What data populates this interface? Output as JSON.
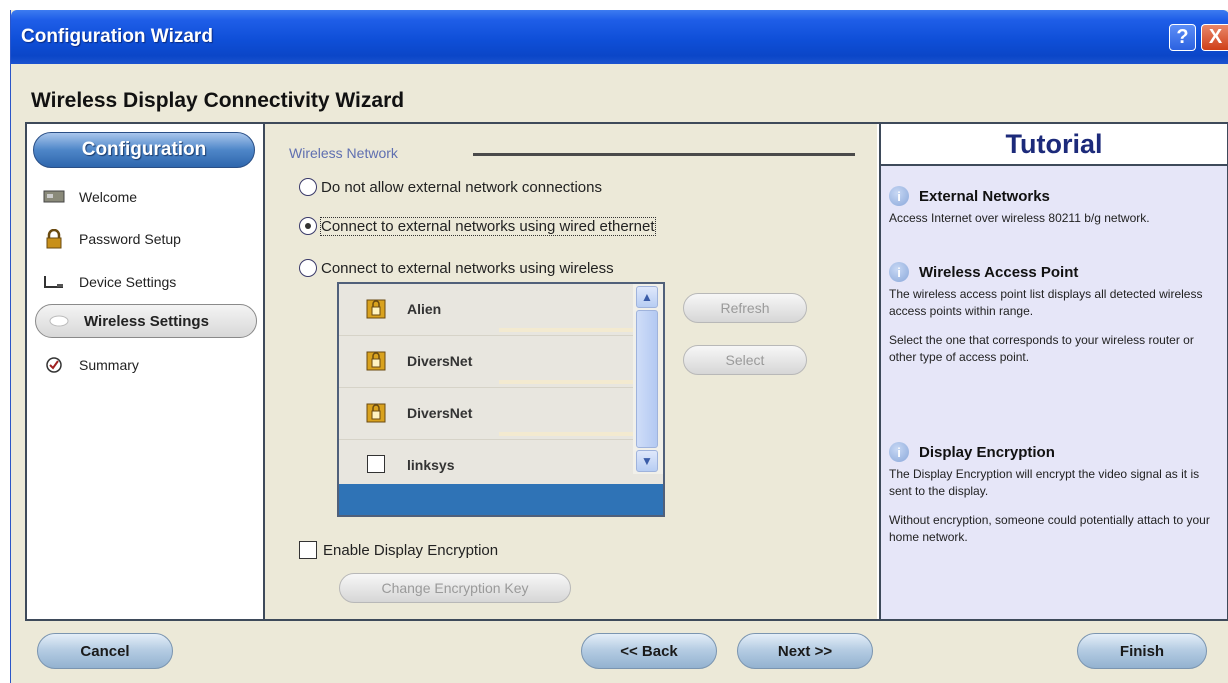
{
  "window": {
    "title": "Configuration Wizard",
    "help_label": "?",
    "close_label": "X"
  },
  "wizard_title": "Wireless Display Connectivity Wizard",
  "sidebar": {
    "header": "Configuration",
    "items": [
      {
        "label": "Welcome",
        "icon": "monitor-icon"
      },
      {
        "label": "Password Setup",
        "icon": "lock-icon"
      },
      {
        "label": "Device Settings",
        "icon": "device-settings-icon"
      },
      {
        "label": "Wireless Settings",
        "icon": "wireless-icon",
        "active": true
      },
      {
        "label": "Summary",
        "icon": "summary-icon"
      }
    ]
  },
  "main": {
    "group_label": "Wireless Network",
    "options": [
      {
        "label": "Do not allow external network connections",
        "selected": false
      },
      {
        "label": "Connect to external networks using wired ethernet",
        "selected": true
      },
      {
        "label": "Connect to external networks using wireless",
        "selected": false
      }
    ],
    "networks": [
      {
        "name": "Alien",
        "secured": true
      },
      {
        "name": "DiversNet",
        "secured": true
      },
      {
        "name": "DiversNet",
        "secured": true
      },
      {
        "name": "linksys",
        "secured": false
      }
    ],
    "refresh_label": "Refresh",
    "select_label": "Select",
    "encryption_checkbox_label": "Enable Display Encryption",
    "change_key_label": "Change Encryption Key"
  },
  "tutorial": {
    "title": "Tutorial",
    "sections": [
      {
        "heading": "External Networks",
        "body": [
          "Access Internet over wireless 80211 b/g network."
        ]
      },
      {
        "heading": "Wireless Access Point",
        "body": [
          "The wireless access point list displays all detected wireless access points within range.",
          "Select the one that corresponds to your wireless router or other type of access point."
        ]
      },
      {
        "heading": "Display Encryption",
        "body": [
          "The Display Encryption will encrypt the video signal as it is sent to the display.",
          "Without encryption, someone could potentially attach to your home network."
        ]
      }
    ]
  },
  "footer": {
    "cancel": "Cancel",
    "back": "<< Back",
    "next": "Next >>",
    "finish": "Finish"
  },
  "colors": {
    "titlebar": "#0f4fd8",
    "tutorial_bg": "#e6e6f8",
    "list_selection": "#2f73b6"
  }
}
